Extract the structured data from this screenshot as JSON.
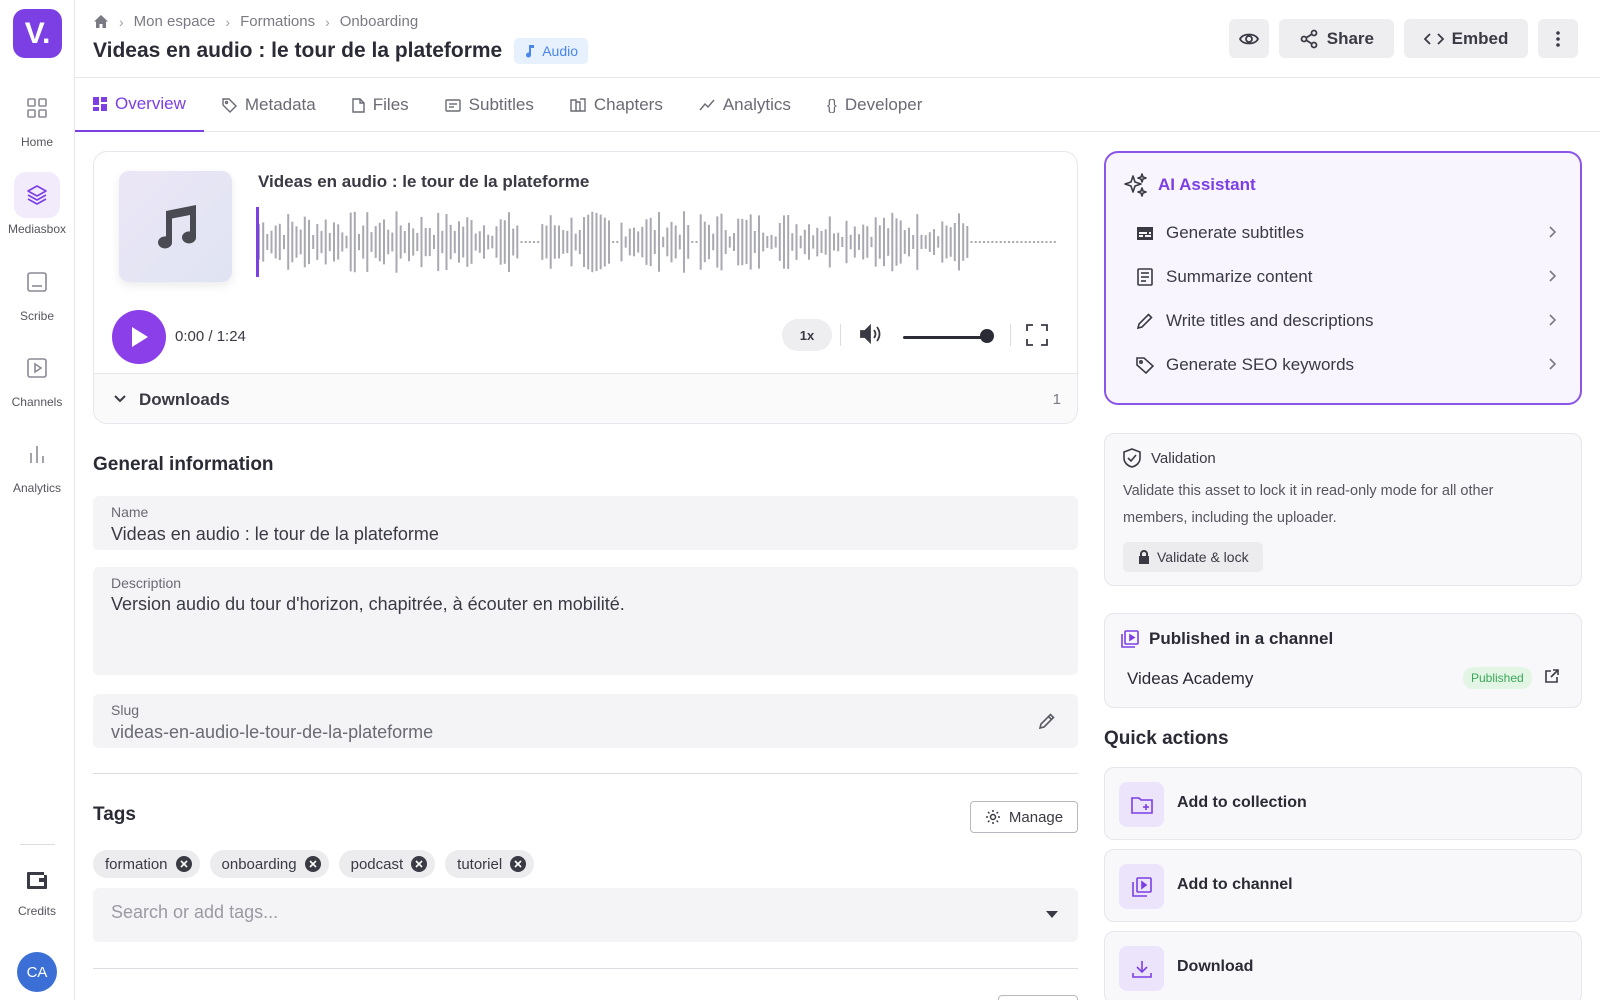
{
  "app": {
    "logo_text": "V."
  },
  "nav": {
    "items": [
      {
        "label": "Home",
        "icon": "grid-icon"
      },
      {
        "label": "Mediasbox",
        "icon": "layers-icon",
        "active": true
      },
      {
        "label": "Scribe",
        "icon": "scribe-icon"
      },
      {
        "label": "Channels",
        "icon": "play-square-icon"
      },
      {
        "label": "Analytics",
        "icon": "bar-chart-icon"
      }
    ],
    "credits_label": "Credits",
    "avatar_initials": "CA"
  },
  "breadcrumb": {
    "items": [
      "Mon espace",
      "Formations",
      "Onboarding"
    ]
  },
  "header": {
    "title": "Videas en audio : le tour de la plateforme",
    "type_badge": "Audio",
    "share_label": "Share",
    "embed_label": "Embed"
  },
  "tabs": [
    {
      "label": "Overview",
      "active": true
    },
    {
      "label": "Metadata"
    },
    {
      "label": "Files"
    },
    {
      "label": "Subtitles"
    },
    {
      "label": "Chapters"
    },
    {
      "label": "Analytics"
    },
    {
      "label": "Developer"
    }
  ],
  "player": {
    "title": "Videas en audio : le tour de la plateforme",
    "time": "0:00 / 1:24",
    "speed": "1x",
    "volume": 1.0,
    "progress": 0.0,
    "downloads_label": "Downloads",
    "downloads_count": "1"
  },
  "general": {
    "title": "General information",
    "name_label": "Name",
    "name_value": "Videas en audio : le tour de la plateforme",
    "description_label": "Description",
    "description_value": "Version audio du tour d'horizon, chapitrée, à écouter en mobilité.",
    "slug_label": "Slug",
    "slug_value": "videas-en-audio-le-tour-de-la-plateforme"
  },
  "tags": {
    "title": "Tags",
    "manage_label": "Manage",
    "items": [
      "formation",
      "onboarding",
      "podcast",
      "tutoriel"
    ],
    "search_placeholder": "Search or add tags..."
  },
  "ai": {
    "title": "AI Assistant",
    "items": [
      {
        "label": "Generate subtitles",
        "icon": "subtitles-icon"
      },
      {
        "label": "Summarize content",
        "icon": "document-icon"
      },
      {
        "label": "Write titles and descriptions",
        "icon": "pencil-icon"
      },
      {
        "label": "Generate SEO keywords",
        "icon": "tag-icon"
      }
    ]
  },
  "validation": {
    "title": "Validation",
    "text": "Validate this asset to lock it in read-only mode for all other members, including the uploader.",
    "button_label": "Validate & lock"
  },
  "published": {
    "title": "Published in a channel",
    "channel_name": "Videas Academy",
    "status": "Published"
  },
  "quick_actions": {
    "title": "Quick actions",
    "items": [
      {
        "label": "Add to collection",
        "icon": "folder-plus-icon"
      },
      {
        "label": "Add to channel",
        "icon": "channel-icon"
      },
      {
        "label": "Download",
        "icon": "download-icon"
      }
    ]
  },
  "colors": {
    "accent": "#7b3fe4",
    "play_button": "#8b3fe8",
    "waveform": "#a9a9b1",
    "published_badge": "#3aa657"
  }
}
